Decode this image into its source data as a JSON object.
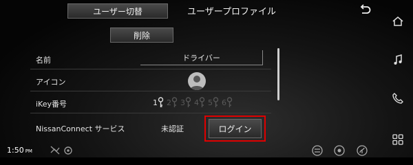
{
  "header": {
    "user_switch_label": "ユーザー切替",
    "title": "ユーザープロファイル",
    "back_icon": "back-arrow-icon"
  },
  "toolbar": {
    "delete_label": "削除"
  },
  "settings": {
    "name": {
      "label": "名前",
      "value": "ドライバー"
    },
    "icon": {
      "label": "アイコン",
      "icon": "user-avatar-icon"
    },
    "ikey": {
      "label": "iKey番号",
      "keys": [
        "1",
        "2",
        "3",
        "4",
        "5",
        "6"
      ],
      "selected": "1"
    },
    "nissanconnect": {
      "label": "NissanConnect サービス",
      "status": "未認証",
      "login_label": "ログイン"
    }
  },
  "status_bar": {
    "time": "1:50",
    "ampm": "PM"
  },
  "side_nav": [
    "home-icon",
    "music-icon",
    "phone-icon",
    "apps-icon"
  ],
  "colors": {
    "highlight": "#e00000"
  }
}
